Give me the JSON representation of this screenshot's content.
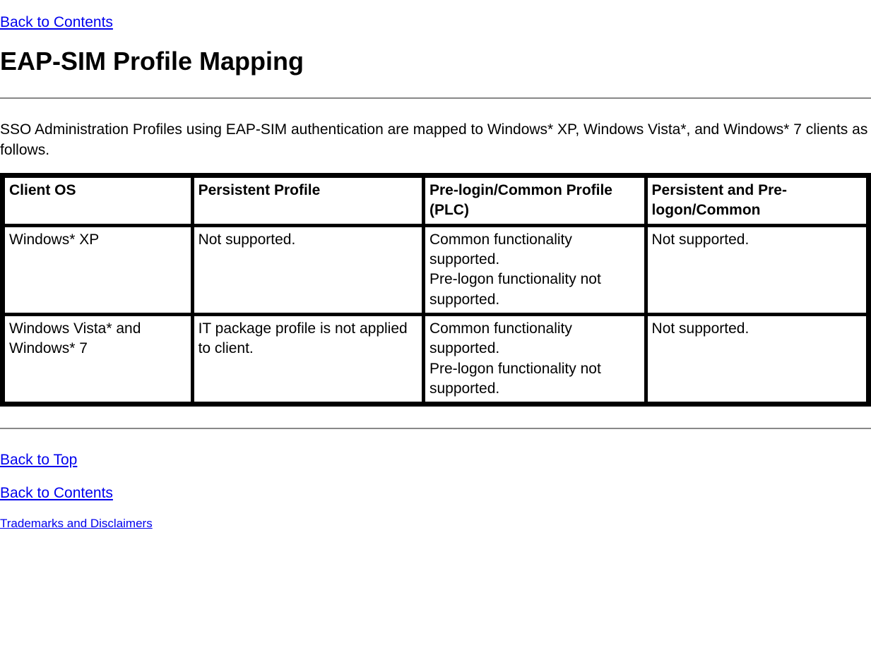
{
  "links": {
    "back_to_contents_top": "Back to Contents",
    "back_to_top": "Back to Top",
    "back_to_contents_bottom": "Back to Contents",
    "trademarks": "Trademarks and Disclaimers"
  },
  "heading": "EAP-SIM Profile Mapping",
  "intro": "SSO Administration Profiles using EAP-SIM authentication are mapped to Windows* XP, Windows Vista*, and Windows* 7 clients as follows.",
  "table": {
    "headers": {
      "col0": "Client OS",
      "col1": "Persistent Profile",
      "col2": "Pre-login/Common Profile (PLC)",
      "col3": "Persistent and Pre-logon/Common"
    },
    "rows": [
      {
        "col0": "Windows* XP",
        "col1": "Not supported.",
        "col2_line1": "Common functionality supported.",
        "col2_line2": "Pre-logon functionality not supported.",
        "col3": "Not supported."
      },
      {
        "col0": "Windows Vista* and Windows* 7",
        "col1": "IT package profile is not applied to client.",
        "col2_line1": "Common functionality supported.",
        "col2_line2": "Pre-logon functionality not supported.",
        "col3": "Not supported."
      }
    ]
  }
}
